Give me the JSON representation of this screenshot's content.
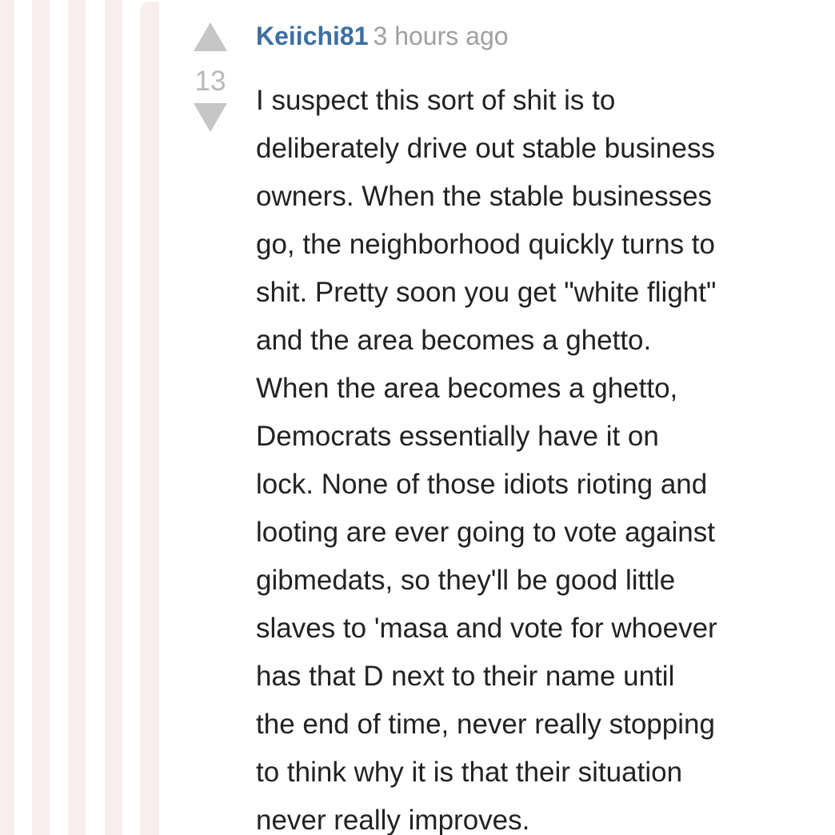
{
  "comment": {
    "author": "Keiichi81",
    "timestamp": "3 hours ago",
    "score": "13",
    "upvote_icon": "triangle-up",
    "downvote_icon": "triangle-down",
    "body_lines": [
      "I suspect this sort of shit is to",
      "deliberately drive out stable business",
      "owners. When the stable businesses",
      "go, the neighborhood quickly turns to",
      "shit. Pretty soon you get \"white flight\"",
      "and the area becomes a ghetto.",
      "When the area becomes a ghetto,",
      "Democrats essentially have it on",
      "lock. None of those idiots rioting and",
      "looting are ever going to vote against",
      "gibmedats, so they'll be good little",
      "slaves to 'masa and vote for whoever",
      "has that D next to their name until",
      "the end of time, never really stopping",
      "to think why it is that their situation",
      "never really improves."
    ]
  },
  "colors": {
    "author": "#3d6fa0",
    "timestamp": "#a0a0a0",
    "score": "#b9b9b9",
    "vote_arrow": "#c6c6c6",
    "body_text": "#222222",
    "thread_stripe": "#f8eeee"
  }
}
